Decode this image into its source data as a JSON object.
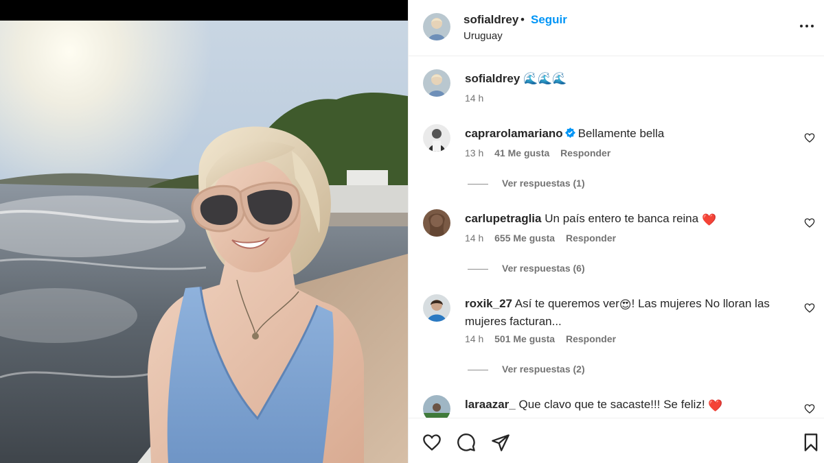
{
  "header": {
    "username": "sofialdrey",
    "separator": "•",
    "follow_label": "Seguir",
    "location": "Uruguay"
  },
  "caption": {
    "username": "sofialdrey",
    "text": "🌊🌊🌊",
    "time": "14 h"
  },
  "comments": [
    {
      "username": "caprarolamariano",
      "verified": true,
      "text": "Bellamente bella",
      "time": "13 h",
      "likes": "41 Me gusta",
      "reply_label": "Responder",
      "view_replies": "Ver respuestas (1)"
    },
    {
      "username": "carlupetraglia",
      "verified": false,
      "text": "Un país entero te banca reina",
      "trailing_emoji": "❤️",
      "time": "14 h",
      "likes": "655 Me gusta",
      "reply_label": "Responder",
      "view_replies": "Ver respuestas (6)"
    },
    {
      "username": "roxik_27",
      "verified": false,
      "text_before": "Así te queremos ver",
      "inline_emoji": "😍",
      "text_after": "! Las mujeres No lloran las mujeres facturan...",
      "time": "14 h",
      "likes": "501 Me gusta",
      "reply_label": "Responder",
      "view_replies": "Ver respuestas (2)"
    },
    {
      "username": "laraazar_",
      "verified": false,
      "text": "Que clavo que te sacaste!!! Se feliz!",
      "trailing_emoji": "❤️"
    }
  ],
  "icons": {
    "like": "heart-icon",
    "comment": "comment-icon",
    "share": "send-icon",
    "save": "bookmark-icon",
    "more": "more-options-icon",
    "verified": "verified-badge-icon"
  },
  "colors": {
    "accent": "#0095f6",
    "heart_red": "#ff3040",
    "secondary_text": "#737373"
  }
}
